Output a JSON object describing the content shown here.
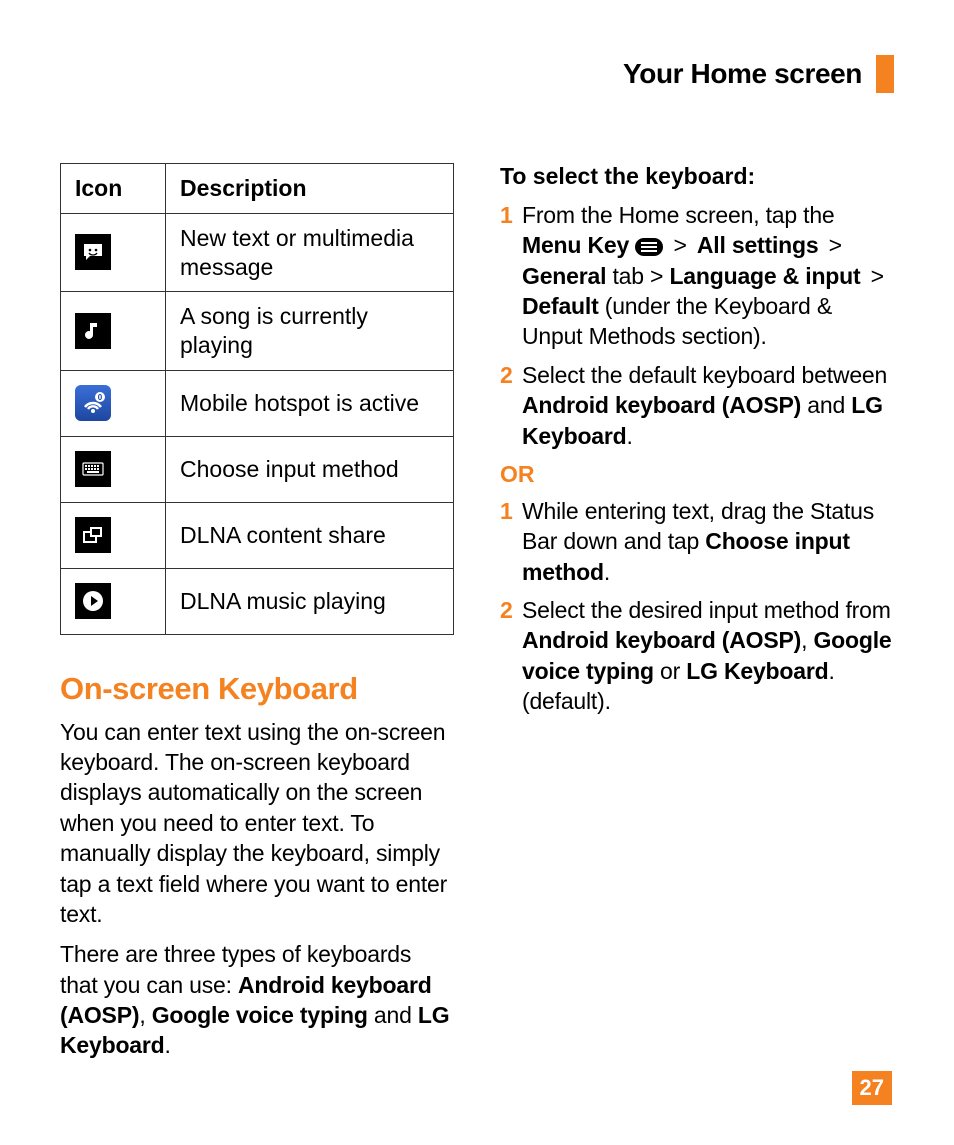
{
  "header": {
    "title": "Your Home screen"
  },
  "table": {
    "headers": {
      "icon": "Icon",
      "desc": "Description"
    },
    "rows": [
      {
        "icon_name": "message-icon",
        "desc": "New text or multimedia message"
      },
      {
        "icon_name": "music-icon",
        "desc": "A song is currently playing"
      },
      {
        "icon_name": "hotspot-icon",
        "desc": "Mobile hotspot is active"
      },
      {
        "icon_name": "keyboard-icon",
        "desc": "Choose input method"
      },
      {
        "icon_name": "dlna-share-icon",
        "desc": "DLNA content share"
      },
      {
        "icon_name": "dlna-play-icon",
        "desc": "DLNA music playing"
      }
    ]
  },
  "section": {
    "heading": "On-screen Keyboard",
    "intro": "You can enter text using the on-screen keyboard. The on-screen keyboard displays automatically on the screen when you need to enter text. To manually display the keyboard, simply tap a text field where you want to enter text.",
    "types_lead": "There are three types of keyboards that you can use: ",
    "types_bold1": "Android keyboard (AOSP)",
    "types_sep1": ", ",
    "types_bold2": "Google voice typing",
    "types_mid": " and ",
    "types_bold3": "LG Keyboard",
    "types_end": "."
  },
  "right": {
    "sub_heading": "To select the keyboard",
    "colon": ":",
    "step1_num": "1",
    "step1_a": "From the Home screen, tap the ",
    "step1_b1": "Menu Key",
    "step1_gt": " > ",
    "step1_b2": "All settings",
    "step1_b3": "General",
    "step1_c": " tab > ",
    "step1_b4": "Language & input",
    "step1_b5": "Default",
    "step1_d": " (under the Keyboard & Unput Methods section).",
    "step2_num": "2",
    "step2_a": "Select the default keyboard between ",
    "step2_b1": "Android keyboard (AOSP)",
    "step2_mid": " and ",
    "step2_b2": "LG Keyboard",
    "step2_end": ".",
    "or": "OR",
    "alt1_num": "1",
    "alt1_a": "While entering text, drag the Status Bar down and tap ",
    "alt1_b": "Choose input method",
    "alt1_end": ".",
    "alt2_num": "2",
    "alt2_a": "Select the desired input method from ",
    "alt2_b1": "Android keyboard (AOSP)",
    "alt2_sep": ", ",
    "alt2_b2": "Google voice typing",
    "alt2_mid": " or ",
    "alt2_b3": "LG Keyboard",
    "alt2_end": ". (default)."
  },
  "page_number": "27"
}
